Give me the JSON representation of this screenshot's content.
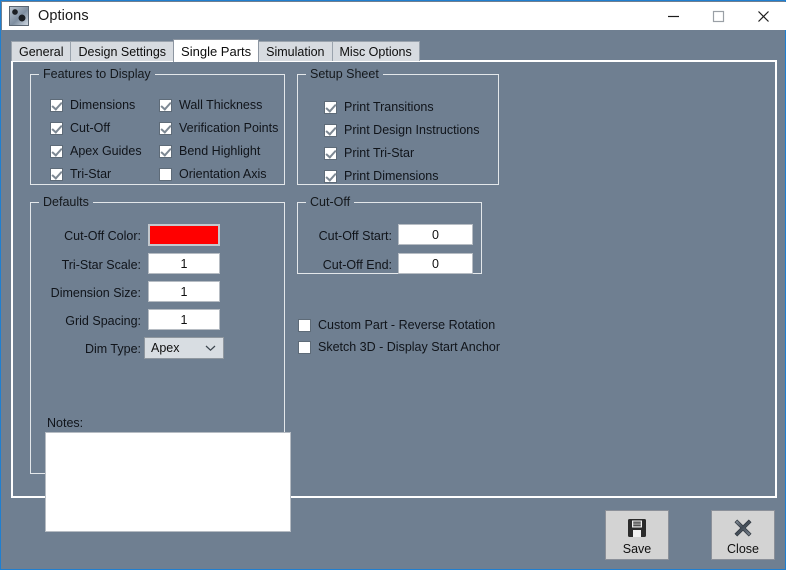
{
  "window": {
    "title": "Options",
    "app_icon": "gears-icon",
    "controls": {
      "minimize": "minimize-icon",
      "maximize": "maximize-icon",
      "close": "close-icon"
    }
  },
  "tabs": [
    {
      "label": "General",
      "active": false
    },
    {
      "label": "Design Settings",
      "active": false
    },
    {
      "label": "Single Parts",
      "active": true
    },
    {
      "label": "Simulation",
      "active": false
    },
    {
      "label": "Misc Options",
      "active": false
    }
  ],
  "features_group": {
    "title": "Features to Display",
    "column1": [
      {
        "label": "Dimensions",
        "checked": true
      },
      {
        "label": "Cut-Off",
        "checked": true
      },
      {
        "label": "Apex Guides",
        "checked": true
      },
      {
        "label": "Tri-Star",
        "checked": true
      }
    ],
    "column2": [
      {
        "label": "Wall Thickness",
        "checked": true
      },
      {
        "label": "Verification Points",
        "checked": true
      },
      {
        "label": "Bend Highlight",
        "checked": true
      },
      {
        "label": "Orientation Axis",
        "checked": false
      }
    ]
  },
  "setup_sheet_group": {
    "title": "Setup Sheet",
    "items": [
      {
        "label": "Print Transitions",
        "checked": true
      },
      {
        "label": "Print Design Instructions",
        "checked": true
      },
      {
        "label": "Print Tri-Star",
        "checked": true
      },
      {
        "label": "Print Dimensions",
        "checked": true
      }
    ]
  },
  "defaults_group": {
    "title": "Defaults",
    "cutoff_color_label": "Cut-Off Color:",
    "cutoff_color_value": "#FF0000",
    "tristar_scale_label": "Tri-Star Scale:",
    "tristar_scale_value": "1",
    "dimension_size_label": "Dimension Size:",
    "dimension_size_value": "1",
    "grid_spacing_label": "Grid Spacing:",
    "grid_spacing_value": "1",
    "dim_type_label": "Dim Type:",
    "dim_type_value": "Apex",
    "notes_label": "Notes:",
    "notes_value": ""
  },
  "cutoff_group": {
    "title": "Cut-Off",
    "start_label": "Cut-Off Start:",
    "start_value": "0",
    "end_label": "Cut-Off End:",
    "end_value": "0"
  },
  "extra_checkboxes": [
    {
      "label": "Custom Part - Reverse Rotation",
      "checked": false
    },
    {
      "label": "Sketch 3D - Display Start Anchor",
      "checked": false
    }
  ],
  "buttons": {
    "save": {
      "label": "Save",
      "icon": "floppy-disk-icon"
    },
    "close": {
      "label": "Close",
      "icon": "x-mark-icon"
    }
  }
}
